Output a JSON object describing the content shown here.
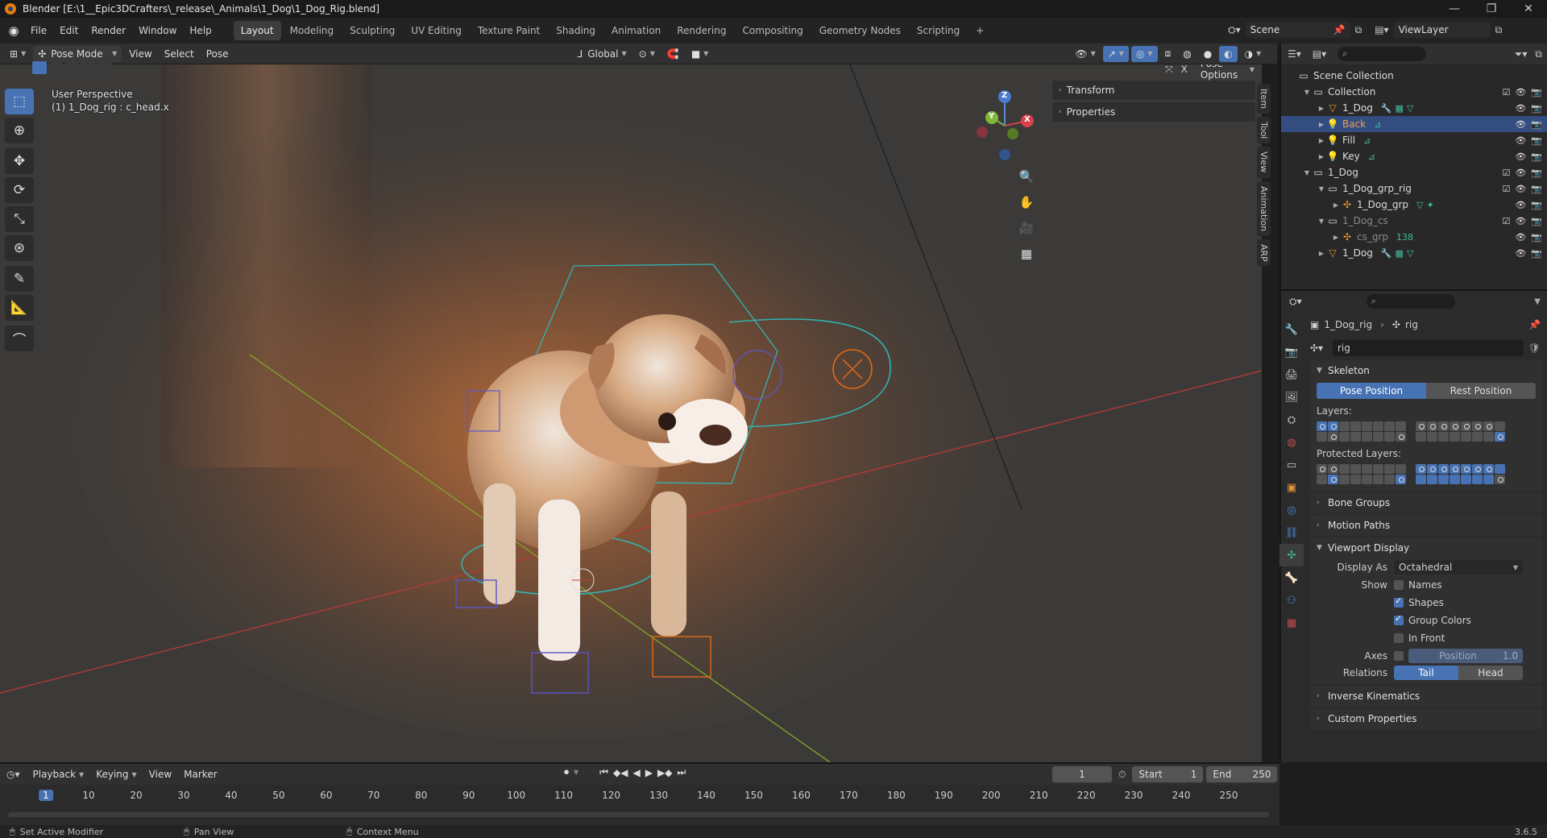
{
  "title": "Blender [E:\\1__Epic3DCrafters\\_release\\_Animals\\1_Dog\\1_Dog_Rig.blend]",
  "window_controls": [
    "—",
    "❐",
    "✕"
  ],
  "menu": [
    "File",
    "Edit",
    "Render",
    "Window",
    "Help"
  ],
  "workspaces": [
    "Layout",
    "Modeling",
    "Sculpting",
    "UV Editing",
    "Texture Paint",
    "Shading",
    "Animation",
    "Rendering",
    "Compositing",
    "Geometry Nodes",
    "Scripting"
  ],
  "add_workspace": "+",
  "scene": {
    "label": "Scene",
    "view_layer": "ViewLayer"
  },
  "viewport_header": {
    "mode": "Pose Mode",
    "menus": [
      "View",
      "Select",
      "Pose"
    ],
    "orientation": "Global",
    "pose_options": "Pose Options"
  },
  "viewport": {
    "perspective": "User Perspective",
    "active": "(1) 1_Dog_rig : c_head.x",
    "gizmo": {
      "z": "Z",
      "y": "Y",
      "x": "X"
    }
  },
  "npanel": {
    "sections": [
      "Transform",
      "Properties"
    ],
    "tabs": [
      "Item",
      "Tool",
      "View",
      "Animation",
      "ARP"
    ]
  },
  "outliner": {
    "rows": [
      {
        "label": "Scene Collection",
        "depth": 0,
        "icon": "collection-icon",
        "arrow": "",
        "selected": false,
        "dim": false,
        "extras": []
      },
      {
        "label": "Collection",
        "depth": 1,
        "icon": "collection-icon",
        "arrow": "▼",
        "selected": false,
        "dim": false,
        "extras": []
      },
      {
        "label": "1_Dog",
        "depth": 2,
        "icon": "mesh-icon",
        "arrow": "▶",
        "selected": false,
        "dim": false,
        "extras": [
          "🔧",
          "▦",
          "▽"
        ]
      },
      {
        "label": "Back",
        "depth": 2,
        "icon": "light-icon",
        "arrow": "▶",
        "selected": true,
        "dim": false,
        "extras": [
          "⊿"
        ]
      },
      {
        "label": "Fill",
        "depth": 2,
        "icon": "light-icon",
        "arrow": "▶",
        "selected": false,
        "dim": false,
        "extras": [
          "⊿"
        ]
      },
      {
        "label": "Key",
        "depth": 2,
        "icon": "light-icon",
        "arrow": "▶",
        "selected": false,
        "dim": false,
        "extras": [
          "⊿"
        ]
      },
      {
        "label": "1_Dog",
        "depth": 1,
        "icon": "collection-icon",
        "arrow": "▼",
        "selected": false,
        "dim": false,
        "extras": []
      },
      {
        "label": "1_Dog_grp_rig",
        "depth": 2,
        "icon": "collection-icon",
        "arrow": "▼",
        "selected": false,
        "dim": false,
        "extras": []
      },
      {
        "label": "1_Dog_grp",
        "depth": 3,
        "icon": "armature-icon",
        "arrow": "▶",
        "selected": false,
        "dim": false,
        "extras": [
          "▽",
          "✦"
        ]
      },
      {
        "label": "1_Dog_cs",
        "depth": 2,
        "icon": "collection-icon",
        "arrow": "▼",
        "selected": false,
        "dim": true,
        "extras": []
      },
      {
        "label": "cs_grp",
        "depth": 3,
        "icon": "armature-icon",
        "arrow": "▶",
        "selected": false,
        "dim": true,
        "extras": [
          "138"
        ]
      },
      {
        "label": "1_Dog",
        "depth": 2,
        "icon": "mesh-icon",
        "arrow": "▶",
        "selected": false,
        "dim": false,
        "extras": [
          "🔧",
          "▦",
          "▽"
        ]
      }
    ]
  },
  "properties": {
    "breadcrumb": [
      "1_Dog_rig",
      "rig"
    ],
    "datablock": "rig",
    "skeleton": {
      "title": "Skeleton",
      "pose_position": "Pose Position",
      "rest_position": "Rest Position",
      "layers_label": "Layers:",
      "protected_label": "Protected Layers:"
    },
    "collapsed_panels": [
      "Bone Groups",
      "Motion Paths"
    ],
    "viewport_display": {
      "title": "Viewport Display",
      "display_as_label": "Display As",
      "display_as_value": "Octahedral",
      "show_label": "Show",
      "options": [
        {
          "label": "Names",
          "checked": false
        },
        {
          "label": "Shapes",
          "checked": true
        },
        {
          "label": "Group Colors",
          "checked": true
        },
        {
          "label": "In Front",
          "checked": false
        }
      ],
      "axes_label": "Axes",
      "axes_position_label": "Position",
      "axes_position_value": "1.0",
      "relations_label": "Relations",
      "relations_tail": "Tail",
      "relations_head": "Head"
    },
    "bottom_panels": [
      "Inverse Kinematics",
      "Custom Properties"
    ]
  },
  "timeline": {
    "menus": [
      "Playback",
      "Keying",
      "View",
      "Marker"
    ],
    "current_frame": "1",
    "start_label": "Start",
    "start": "1",
    "end_label": "End",
    "end": "250",
    "ticks": [
      "1",
      "10",
      "20",
      "30",
      "40",
      "50",
      "60",
      "70",
      "80",
      "90",
      "100",
      "110",
      "120",
      "130",
      "140",
      "150",
      "160",
      "170",
      "180",
      "190",
      "200",
      "210",
      "220",
      "230",
      "240",
      "250"
    ]
  },
  "statusbar": {
    "items": [
      "Set Active Modifier",
      "Pan View",
      "Context Menu"
    ],
    "version": "3.6.5"
  },
  "colors": {
    "accent": "#4772b3",
    "selected_row": "#334d80",
    "orange": "#e87d0d"
  }
}
